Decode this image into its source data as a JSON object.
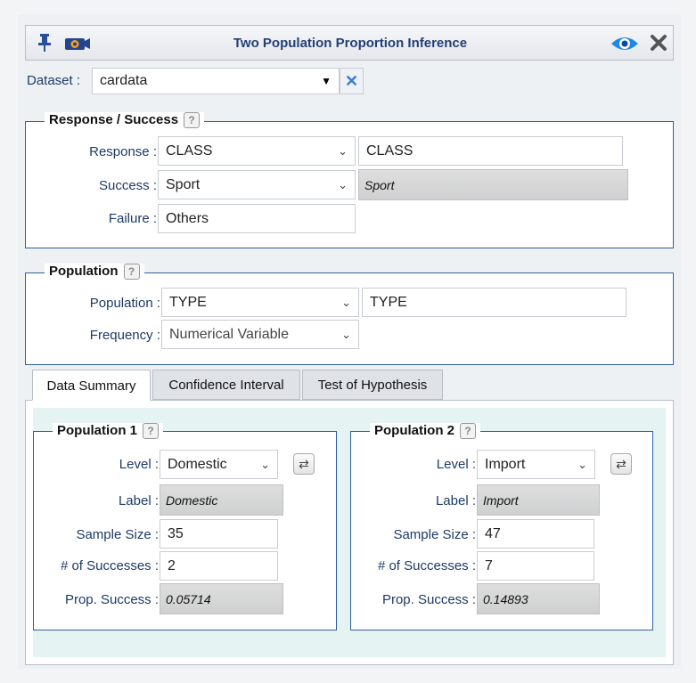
{
  "window": {
    "title": "Two Population Proportion Inference"
  },
  "icons": {
    "pin": "pin-icon",
    "camera": "camera-icon",
    "eye": "eye-icon",
    "close": "close-icon"
  },
  "dataset": {
    "label": "Dataset :",
    "value": "cardata"
  },
  "response_section": {
    "legend": "Response / Success",
    "response_label": "Response :",
    "response_value": "CLASS",
    "response_text": "CLASS",
    "success_label": "Success :",
    "success_value": "Sport",
    "success_display": "Sport",
    "failure_label": "Failure :",
    "failure_value": "Others"
  },
  "population_section": {
    "legend": "Population",
    "population_label": "Population :",
    "population_value": "TYPE",
    "population_text": "TYPE",
    "frequency_label": "Frequency :",
    "frequency_value": "Numerical Variable"
  },
  "tabs": [
    "Data Summary",
    "Confidence Interval",
    "Test of Hypothesis"
  ],
  "pop1": {
    "legend": "Population 1",
    "level_label": "Level :",
    "level_value": "Domestic",
    "label_label": "Label :",
    "label_value": "Domestic",
    "size_label": "Sample Size :",
    "size_value": "35",
    "succ_label": "# of Successes :",
    "succ_value": "2",
    "prop_label": "Prop. Success :",
    "prop_value": "0.05714"
  },
  "pop2": {
    "legend": "Population 2",
    "level_label": "Level :",
    "level_value": "Import",
    "label_label": "Label :",
    "label_value": "Import",
    "size_label": "Sample Size :",
    "size_value": "47",
    "succ_label": "# of Successes :",
    "succ_value": "7",
    "prop_label": "Prop. Success :",
    "prop_value": "0.14893"
  },
  "help_glyph": "?",
  "colors": {
    "accent": "#2d5f9a",
    "title_text": "#233f73"
  }
}
